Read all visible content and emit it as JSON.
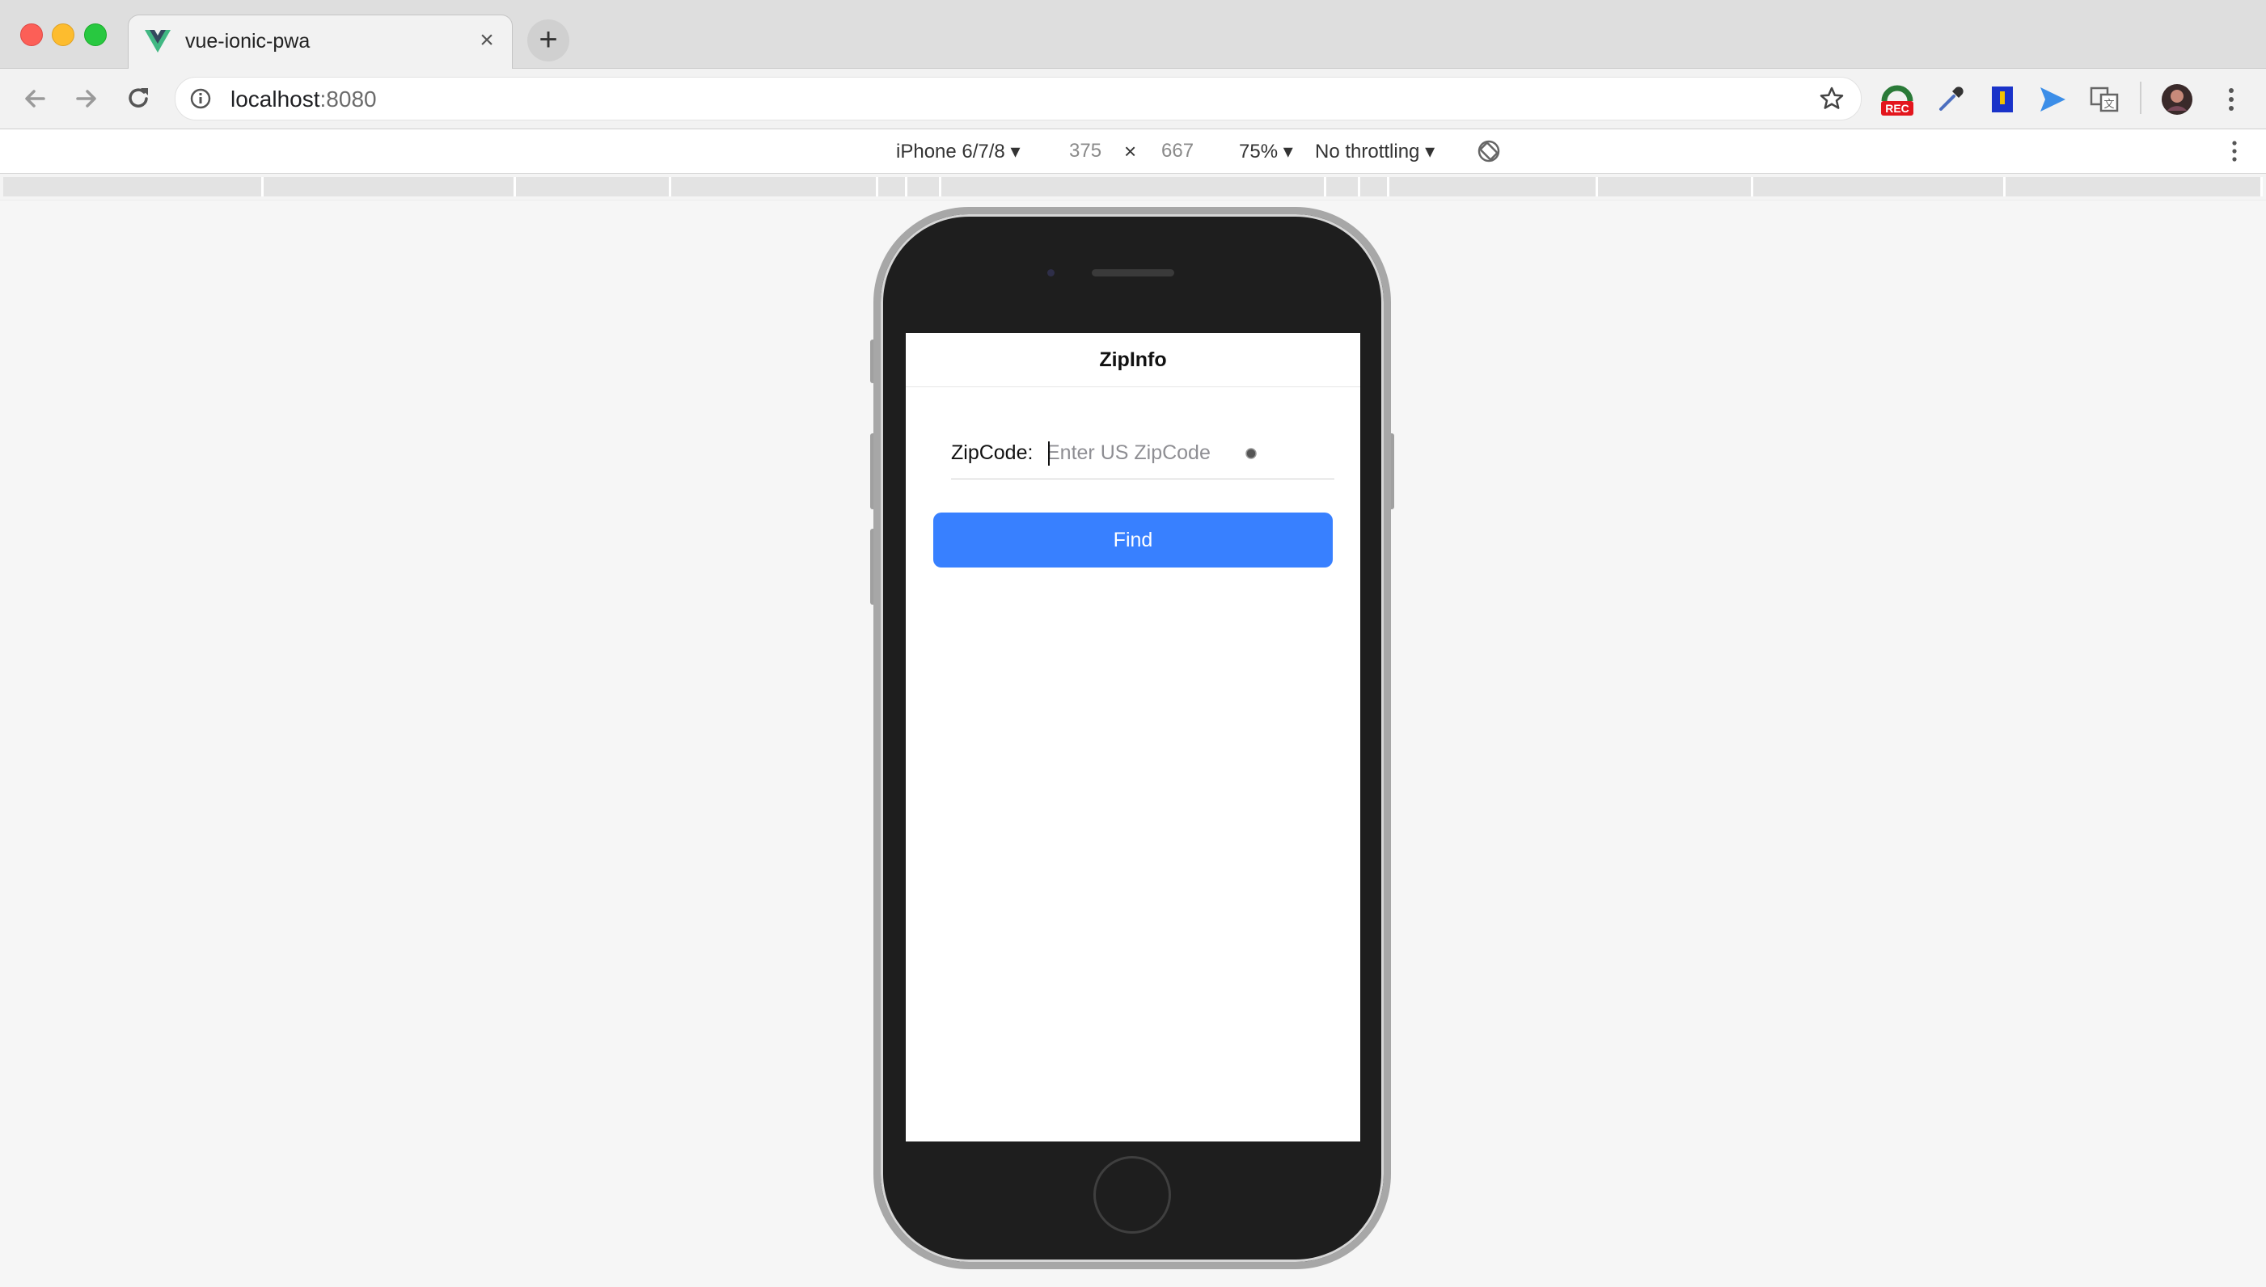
{
  "browser": {
    "tab": {
      "title": "vue-ionic-pwa",
      "favicon": "vue-logo-icon",
      "close_glyph": "×"
    },
    "new_tab_glyph": "+",
    "address": {
      "host": "localhost",
      "port": ":8080"
    },
    "extensions": [
      "speed-dial-icon",
      "eyedropper-icon",
      "bookmark-ext-icon",
      "send-icon",
      "translate-icon",
      "profile-avatar"
    ],
    "extension_badge": "REC"
  },
  "devtools": {
    "device": "iPhone 6/7/8",
    "width": "375",
    "times": "×",
    "height": "667",
    "zoom": "75%",
    "throttling": "No throttling"
  },
  "app": {
    "title": "ZipInfo",
    "zip_label": "ZipCode:",
    "zip_placeholder": "Enter US ZipCode",
    "zip_value": "",
    "find_label": "Find"
  },
  "colors": {
    "accent": "#3880ff",
    "close_light": "#fc5f57",
    "minimize_light": "#fdbc2e",
    "zoom_light": "#28c840",
    "rec_badge": "#e3161d"
  }
}
